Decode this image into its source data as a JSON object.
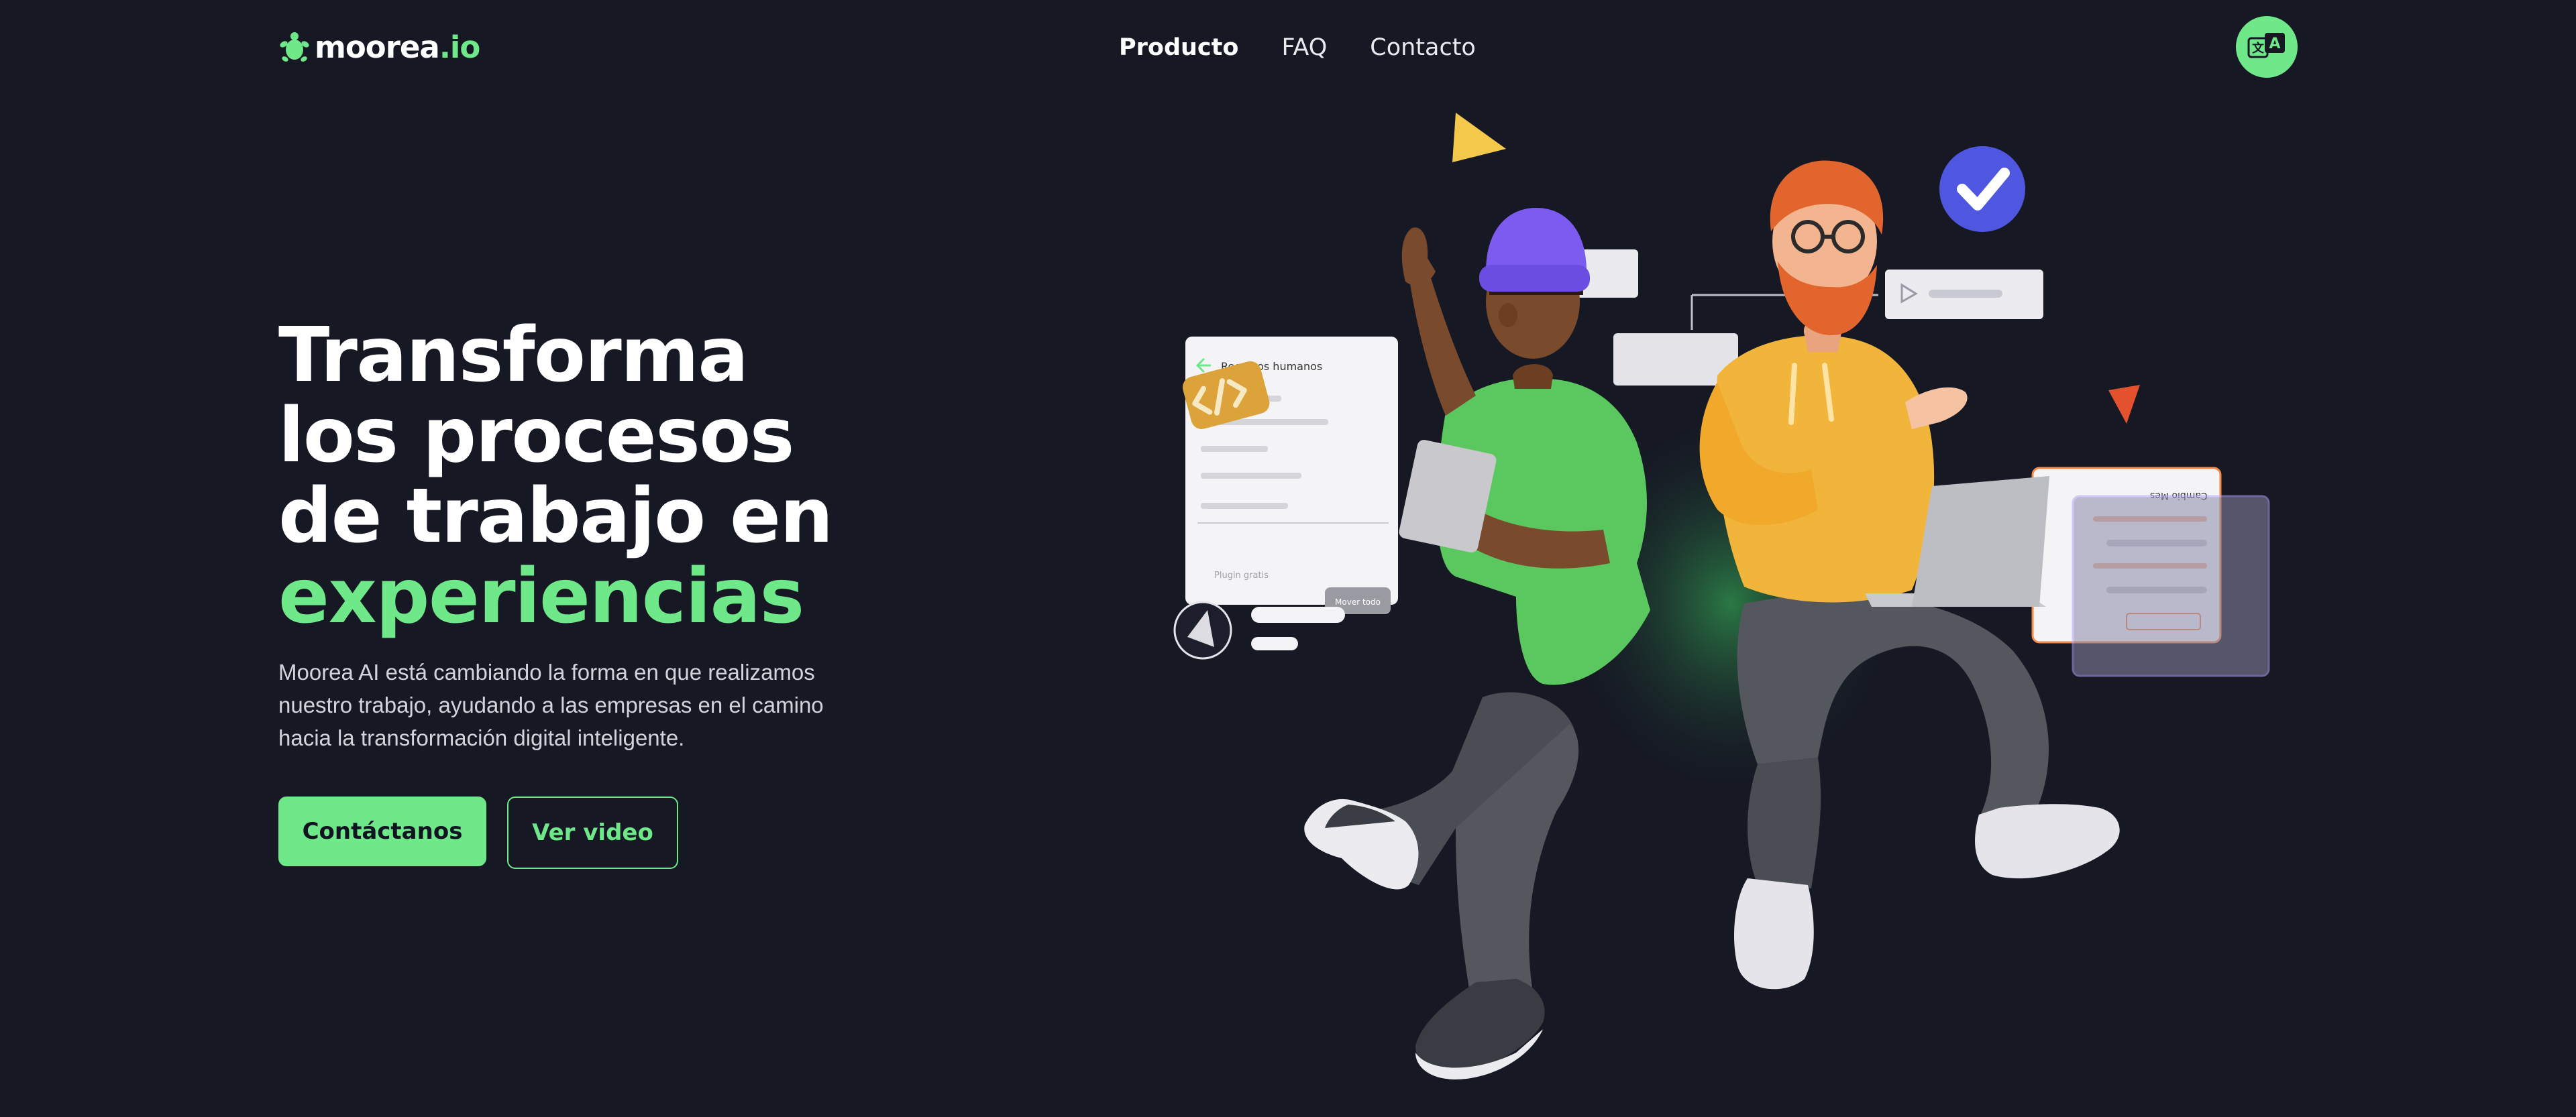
{
  "header": {
    "logo_main": "moorea",
    "logo_accent": ".io",
    "nav": [
      {
        "label": "Producto",
        "active": true
      },
      {
        "label": "FAQ",
        "active": false
      },
      {
        "label": "Contacto",
        "active": false
      }
    ],
    "language_icon": "translate-icon"
  },
  "hero": {
    "title_lines": [
      "Transforma",
      "los procesos",
      "de trabajo en"
    ],
    "title_accent": "experiencias",
    "description": "Moorea AI está cambiando la forma en que realizamos nuestro trabajo, ayudando a las empresas en el camino hacia la transformación digital inteligente.",
    "primary_cta": "Contáctanos",
    "secondary_cta": "Ver video"
  },
  "illustration": {
    "card_left_title": "Recursos humanos",
    "card_left_footer": "Plugin gratis",
    "card_left_button": "Mover todo",
    "card_right_title": "Cambio Mes"
  },
  "colors": {
    "background": "#161824",
    "accent": "#6ee889",
    "text": "#ffffff"
  }
}
